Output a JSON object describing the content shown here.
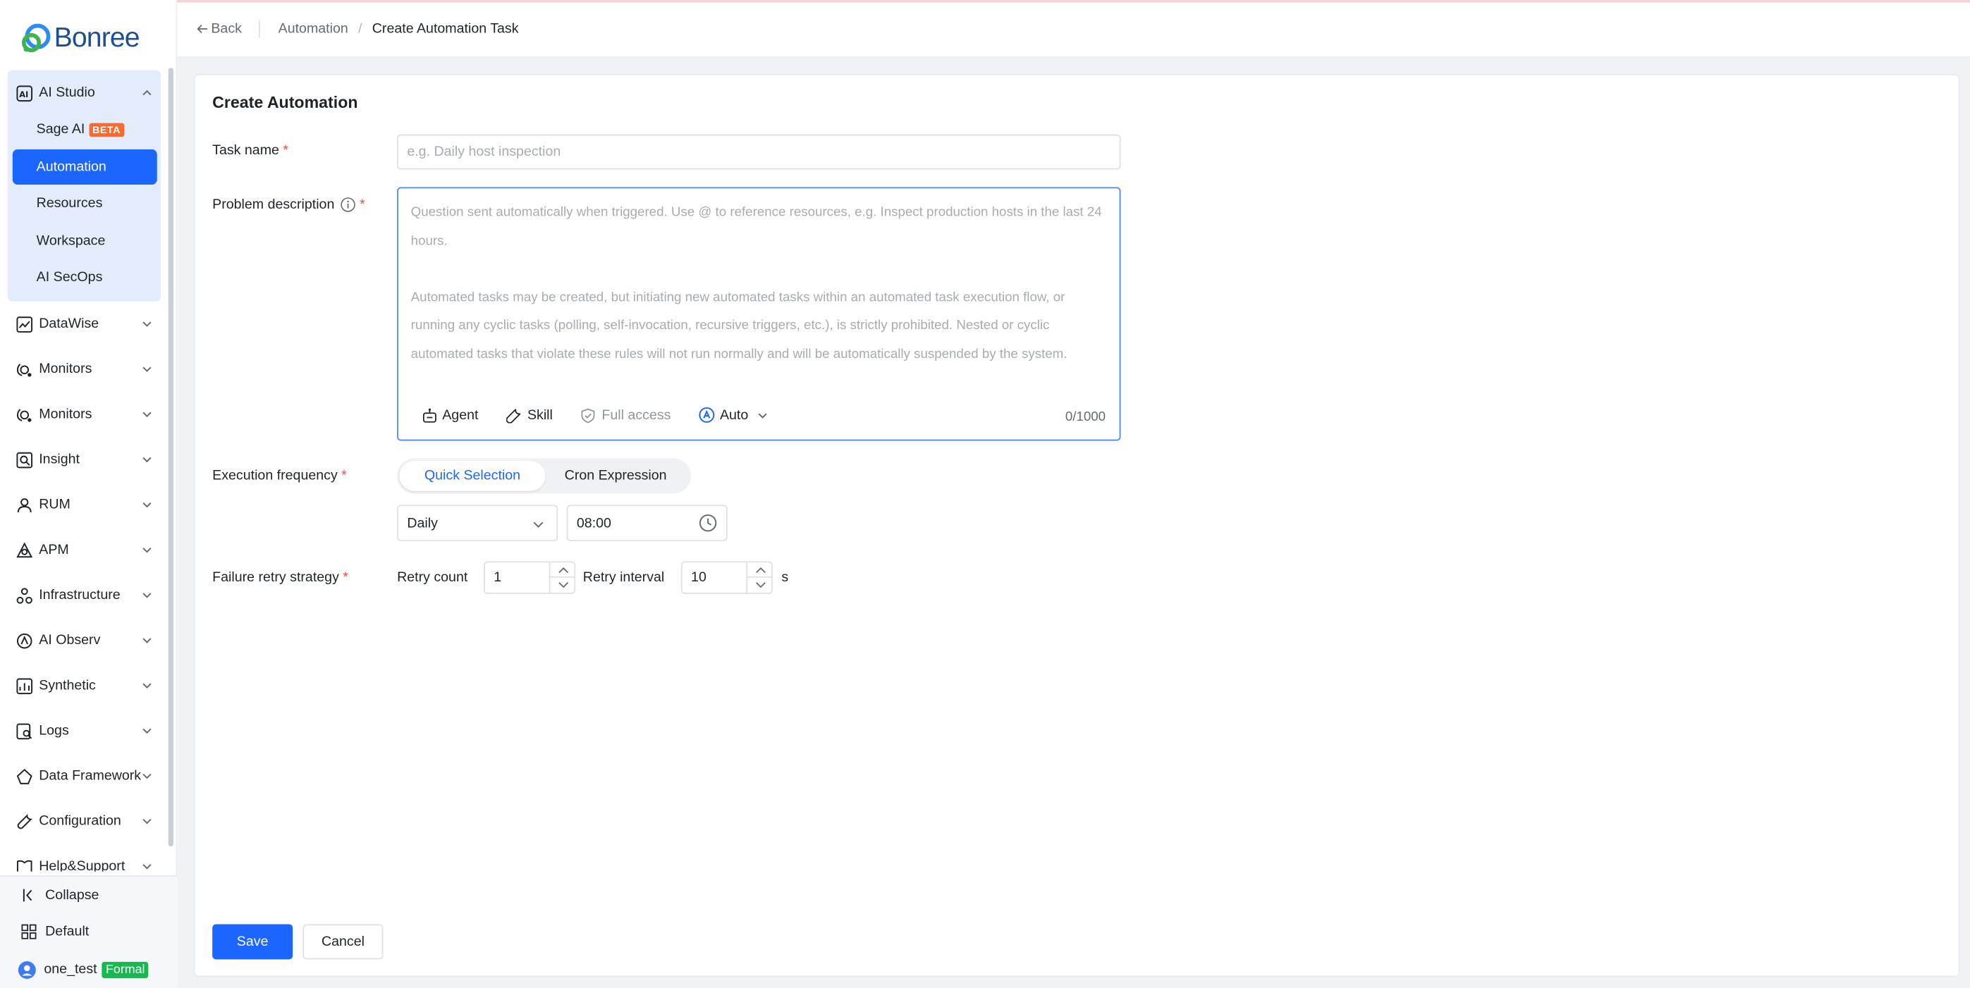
{
  "brand": {
    "name": "Bonree"
  },
  "sidebar": {
    "group_open": {
      "label": "AI Studio",
      "children": [
        "Sage AI",
        "Automation",
        "Resources",
        "Workspace",
        "AI SecOps"
      ],
      "beta_badge": "BETA"
    },
    "items": [
      "DataWise",
      "Monitors",
      "Monitors",
      "Insight",
      "RUM",
      "APM",
      "Infrastructure",
      "AI Observ",
      "Synthetic",
      "Logs",
      "Data Framework",
      "Configuration",
      "Help&Support"
    ],
    "bottom": {
      "collapse": "Collapse",
      "workspace": "Default",
      "user": "one_test",
      "user_badge": "Formal"
    }
  },
  "header": {
    "back": "Back",
    "breadcrumb": [
      "Automation",
      "/",
      "Create Automation Task"
    ]
  },
  "form": {
    "title": "Create Automation",
    "task_name": {
      "label": "Task name",
      "required": "*",
      "placeholder": "e.g. Daily host inspection"
    },
    "problem": {
      "label": "Problem description",
      "required": "*",
      "placeholder_line1": "Question sent automatically when triggered. Use @ to reference resources, e.g. Inspect production hosts in the last 24 hours.",
      "placeholder_line2": "Automated tasks may be created, but initiating new automated tasks within an automated task execution flow, or running any cyclic tasks (polling, self-invocation, recursive triggers, etc.), is strictly prohibited. Nested or cyclic automated tasks that violate these rules will not run normally and will be automatically suspended by the system.",
      "tools": [
        "Agent",
        "Skill",
        "Full access",
        "Auto"
      ],
      "counter": "0/1000"
    },
    "frequency": {
      "label": "Execution frequency",
      "required": "*",
      "tabs": [
        "Quick Selection",
        "Cron Expression"
      ],
      "period": "Daily",
      "time": "08:00"
    },
    "retry": {
      "label": "Failure retry strategy",
      "required": "*",
      "count_label": "Retry count",
      "count": "1",
      "interval_label": "Retry interval",
      "interval": "10",
      "unit": "s"
    },
    "save": "Save",
    "cancel": "Cancel"
  },
  "colors": {
    "primary": "#1a66ff",
    "beta": "#ff6a2b",
    "formal": "#16b94f",
    "required": "#f54a45"
  }
}
